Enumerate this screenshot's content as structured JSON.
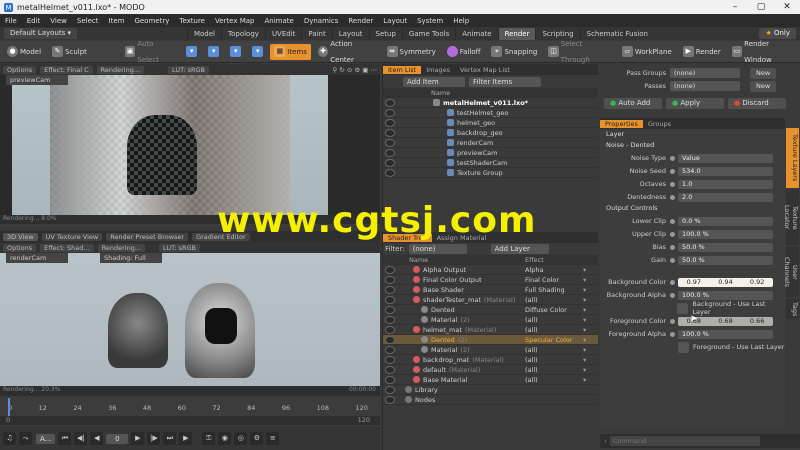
{
  "window": {
    "title": "metalHelmet_v011.lxo* - MODO",
    "controls": [
      "–",
      "▢",
      "✕"
    ]
  },
  "menu": [
    "File",
    "Edit",
    "View",
    "Select",
    "Item",
    "Geometry",
    "Texture",
    "Vertex Map",
    "Animate",
    "Dynamics",
    "Render",
    "Layout",
    "System",
    "Help"
  ],
  "layout_tabs": {
    "layouts_button": "Default Layouts ▾",
    "tabs": [
      "Model",
      "Topology",
      "UVEdit",
      "Paint",
      "Layout",
      "Setup",
      "Game Tools",
      "Animate",
      "Render",
      "Scripting",
      "Schematic Fusion"
    ],
    "active": "Render",
    "only_label": "Only"
  },
  "toolbar": {
    "mode": "Model",
    "sculpt": "Sculpt",
    "auto_select": "Auto Select",
    "items": "Items",
    "action_center": "Action Center",
    "symmetry": "Symmetry",
    "falloff": "Falloff",
    "snapping": "Snapping",
    "select_through": "Select Through",
    "workplane": "WorkPlane",
    "render": "Render",
    "render_window": "Render Window"
  },
  "viewport_top": {
    "options": "Options",
    "effect": "Effect: Final C",
    "rendering": "Rendering...",
    "lut": "LUT: sRGB",
    "preview": "previewCam",
    "status": "Rendering... 8.0%"
  },
  "viewport_bottom": {
    "tabs": [
      "3D View",
      "UV Texture View",
      "Render Preset Browser",
      "Gradient Editor"
    ],
    "options": "Options",
    "effect": "Effect: Shad...",
    "rendering": "Rendering...",
    "lut": "LUT: sRGB",
    "cam": "renderCam",
    "shading": "Shading: Full",
    "status": "Rendering... 20.3%",
    "time": "00:00:00"
  },
  "timeline": {
    "ticks": [
      "0",
      "12",
      "24",
      "36",
      "48",
      "60",
      "72",
      "84",
      "96",
      "108",
      "120"
    ],
    "start": "0",
    "end": "120",
    "frame": "0"
  },
  "transport": {
    "anim": "A...",
    "frame_value": "0",
    "play": "Play"
  },
  "item_list": {
    "tabs": [
      "Item List",
      "Images",
      "Vertex Map List"
    ],
    "add_item": "Add Item",
    "filter_items": "Filter Items",
    "col_name": "Name",
    "items": [
      {
        "name": "metalHelmet_v011.lxo*",
        "bold": true,
        "indent": 0
      },
      {
        "name": "testHelmet_geo",
        "indent": 1
      },
      {
        "name": "helmet_geo",
        "indent": 1
      },
      {
        "name": "backdrop_geo",
        "indent": 1
      },
      {
        "name": "renderCam",
        "indent": 1
      },
      {
        "name": "previewCam",
        "indent": 1
      },
      {
        "name": "testShaderCam",
        "indent": 1
      },
      {
        "name": "Texture Group",
        "indent": 1
      }
    ]
  },
  "shader_tree": {
    "tabs": [
      "Shader Tree",
      "Assign Material"
    ],
    "filter": "Filter:",
    "filter_value": "(none)",
    "add_layer": "Add Layer",
    "col_name": "Name",
    "col_effect": "Effect",
    "rows": [
      {
        "name": "Alpha Output",
        "effect": "Alpha",
        "indent": 1
      },
      {
        "name": "Final Color Output",
        "effect": "Final Color",
        "indent": 1
      },
      {
        "name": "Base Shader",
        "effect": "Full Shading",
        "indent": 1
      },
      {
        "name": "shaderTester_mat",
        "tag": "(Material)",
        "effect": "(all)",
        "indent": 1
      },
      {
        "name": "Dented",
        "effect": "Diffuse Color",
        "indent": 2
      },
      {
        "name": "Material",
        "tag": "(2)",
        "effect": "(all)",
        "indent": 2
      },
      {
        "name": "helmet_mat",
        "tag": "(Material)",
        "effect": "(all)",
        "indent": 1
      },
      {
        "name": "Dented",
        "tag": "(2)",
        "effect": "Specular Color",
        "indent": 2,
        "selected": true
      },
      {
        "name": "Material",
        "tag": "(2)",
        "effect": "(all)",
        "indent": 2
      },
      {
        "name": "backdrop_mat",
        "tag": "(Material)",
        "effect": "(all)",
        "indent": 1
      },
      {
        "name": "default",
        "tag": "(Material)",
        "effect": "(all)",
        "indent": 1
      },
      {
        "name": "Base Material",
        "effect": "(all)",
        "indent": 1
      },
      {
        "name": "Library",
        "effect": "",
        "indent": 0
      },
      {
        "name": "Nodes",
        "effect": "",
        "indent": 0
      }
    ]
  },
  "pass_groups": {
    "pass_label": "Pass Groups",
    "pass_value": "(none)",
    "passes_label": "Passes",
    "passes_value": "(none)",
    "new": "New",
    "auto_add": "Auto Add",
    "apply": "Apply",
    "discard": "Discard"
  },
  "properties": {
    "tabs": [
      "Properties",
      "Groups"
    ],
    "layer": "Layer",
    "section": "Noise - Dented",
    "noise_type_label": "Noise Type",
    "noise_type": "Value",
    "noise_seed_label": "Noise Seed",
    "noise_seed": "534.0",
    "octaves_label": "Octaves",
    "octaves": "1.0",
    "dentedness_label": "Dentedness",
    "dentedness": "2.0",
    "output_controls": "Output Controls",
    "lower_clip_label": "Lower Clip",
    "lower_clip": "0.0 %",
    "upper_clip_label": "Upper Clip",
    "upper_clip": "100.0 %",
    "bias_label": "Bias",
    "bias": "50.0 %",
    "gain_label": "Gain",
    "gain": "50.0 %",
    "bg_color_label": "Background Color",
    "bg_color": [
      "0.97",
      "0.94",
      "0.92"
    ],
    "bg_alpha_label": "Background Alpha",
    "bg_alpha": "100.0 %",
    "bg_last": "Background - Use Last Layer",
    "fg_color_label": "Foreground Color",
    "fg_color": [
      "0.68",
      "0.68",
      "0.66"
    ],
    "fg_alpha_label": "Foreground Alpha",
    "fg_alpha": "100.0 %",
    "fg_last": "Foreground - Use Last Layer",
    "side_tabs": [
      "Texture Layers",
      "Texture Locator",
      "User Channels",
      "Tags"
    ],
    "command_placeholder": "Command"
  },
  "watermark": "www.cgtsj.com",
  "colors": {
    "accent": "#e8922e",
    "watermark": "#f4f000"
  }
}
